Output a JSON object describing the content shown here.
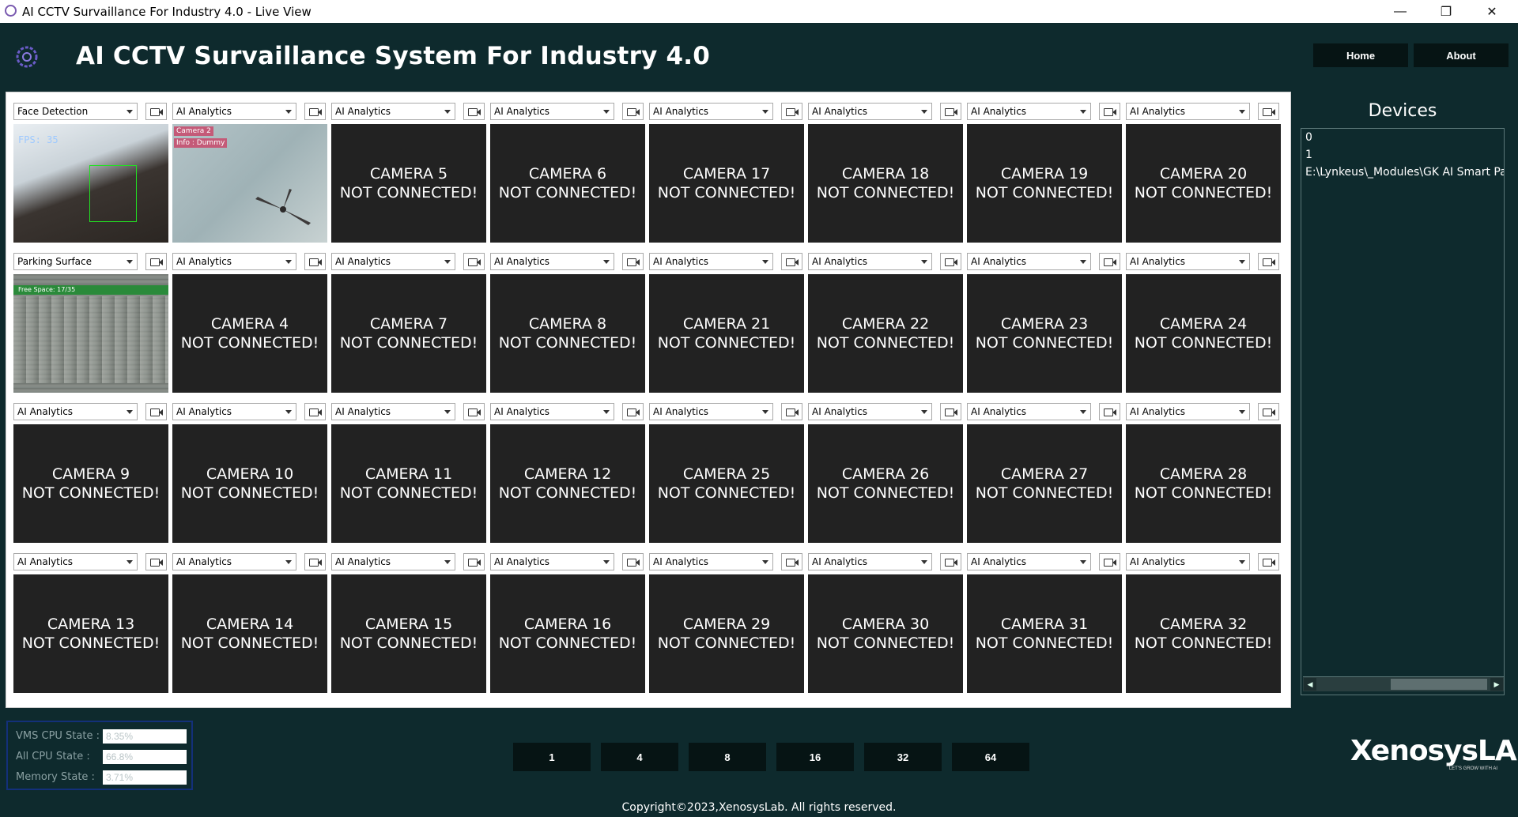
{
  "window": {
    "title": "AI CCTV Survaillance For Industry 4.0 - Live View",
    "minimize": "—",
    "restore": "❐",
    "close": "✕"
  },
  "header": {
    "title": "AI CCTV Survaillance System For Industry 4.0",
    "nav": {
      "home": "Home",
      "about": "About"
    }
  },
  "cameras": {
    "rows": [
      [
        {
          "mode": "Face Detection",
          "feed": true,
          "overlay": "FPS: 35"
        },
        {
          "mode": "AI Analytics",
          "feed": true,
          "overlay": "Camera 2",
          "overlay2": "Info : Dummy"
        },
        {
          "mode": "AI Analytics",
          "name": "CAMERA 5",
          "status": "NOT CONNECTED!"
        },
        {
          "mode": "AI Analytics",
          "name": "CAMERA 6",
          "status": "NOT CONNECTED!"
        },
        {
          "mode": "AI Analytics",
          "name": "CAMERA 17",
          "status": "NOT CONNECTED!"
        },
        {
          "mode": "AI Analytics",
          "name": "CAMERA 18",
          "status": "NOT CONNECTED!"
        },
        {
          "mode": "AI Analytics",
          "name": "CAMERA 19",
          "status": "NOT CONNECTED!"
        },
        {
          "mode": "AI Analytics",
          "name": "CAMERA 20",
          "status": "NOT CONNECTED!"
        }
      ],
      [
        {
          "mode": "Parking Surface",
          "feed": true,
          "overlay": "Free Space: 17/35"
        },
        {
          "mode": "AI Analytics",
          "name": "CAMERA 4",
          "status": "NOT CONNECTED!"
        },
        {
          "mode": "AI Analytics",
          "name": "CAMERA 7",
          "status": "NOT CONNECTED!"
        },
        {
          "mode": "AI Analytics",
          "name": "CAMERA 8",
          "status": "NOT CONNECTED!"
        },
        {
          "mode": "AI Analytics",
          "name": "CAMERA 21",
          "status": "NOT CONNECTED!"
        },
        {
          "mode": "AI Analytics",
          "name": "CAMERA 22",
          "status": "NOT CONNECTED!"
        },
        {
          "mode": "AI Analytics",
          "name": "CAMERA 23",
          "status": "NOT CONNECTED!"
        },
        {
          "mode": "AI Analytics",
          "name": "CAMERA 24",
          "status": "NOT CONNECTED!"
        }
      ],
      [
        {
          "mode": "AI Analytics",
          "name": "CAMERA 9",
          "status": "NOT CONNECTED!"
        },
        {
          "mode": "AI Analytics",
          "name": "CAMERA 10",
          "status": "NOT CONNECTED!"
        },
        {
          "mode": "AI Analytics",
          "name": "CAMERA 11",
          "status": "NOT CONNECTED!"
        },
        {
          "mode": "AI Analytics",
          "name": "CAMERA 12",
          "status": "NOT CONNECTED!"
        },
        {
          "mode": "AI Analytics",
          "name": "CAMERA 25",
          "status": "NOT CONNECTED!"
        },
        {
          "mode": "AI Analytics",
          "name": "CAMERA 26",
          "status": "NOT CONNECTED!"
        },
        {
          "mode": "AI Analytics",
          "name": "CAMERA 27",
          "status": "NOT CONNECTED!"
        },
        {
          "mode": "AI Analytics",
          "name": "CAMERA 28",
          "status": "NOT CONNECTED!"
        }
      ],
      [
        {
          "mode": "AI Analytics",
          "name": "CAMERA 13",
          "status": "NOT CONNECTED!"
        },
        {
          "mode": "AI Analytics",
          "name": "CAMERA 14",
          "status": "NOT CONNECTED!"
        },
        {
          "mode": "AI Analytics",
          "name": "CAMERA 15",
          "status": "NOT CONNECTED!"
        },
        {
          "mode": "AI Analytics",
          "name": "CAMERA 16",
          "status": "NOT CONNECTED!"
        },
        {
          "mode": "AI Analytics",
          "name": "CAMERA 29",
          "status": "NOT CONNECTED!"
        },
        {
          "mode": "AI Analytics",
          "name": "CAMERA 30",
          "status": "NOT CONNECTED!"
        },
        {
          "mode": "AI Analytics",
          "name": "CAMERA 31",
          "status": "NOT CONNECTED!"
        },
        {
          "mode": "AI Analytics",
          "name": "CAMERA 32",
          "status": "NOT CONNECTED!"
        }
      ]
    ]
  },
  "devices": {
    "title": "Devices",
    "items": [
      "0",
      "1",
      "E:\\Lynkeus\\_Modules\\GK AI Smart Parking"
    ],
    "scroll_left": "◀",
    "scroll_right": "▶"
  },
  "stats": {
    "vms_label": "VMS CPU State :",
    "vms_value": "8.35%",
    "all_label": "All CPU State    :",
    "all_value": "66.8%",
    "mem_label": "Memory State   :",
    "mem_value": "3.71%"
  },
  "grid_buttons": [
    "1",
    "4",
    "8",
    "16",
    "32",
    "64"
  ],
  "brand": {
    "name": "XenosysLAB",
    "tagline": "LET'S GROW WITH AI"
  },
  "footer": {
    "copyright": "Copyright©2023,XenosysLab. All rights reserved."
  },
  "colors": {
    "background": "#0e2a2d",
    "tile": "#222222",
    "button": "#061414"
  }
}
